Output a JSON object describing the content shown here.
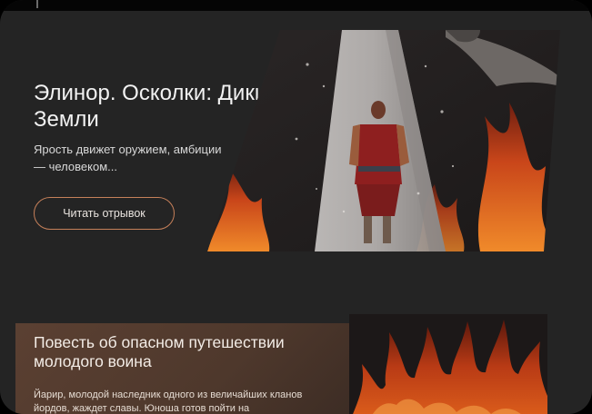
{
  "hero": {
    "title": "Элинор. Осколки: Дикие Земли",
    "subtitle": "Ярость движет оружием, амбиции — человеком...",
    "cta_label": "Читать отрывок"
  },
  "story": {
    "title": "Повесть об опасном путешествии молодого воина",
    "text": "Йарир, молодой наследник одного из величайших кланов йордов, жаждет славы. Юноша готов пойти на"
  },
  "colors": {
    "background": "#242424",
    "accent": "#c6805a",
    "card": "#553b2e",
    "fire": "#e0621c"
  }
}
